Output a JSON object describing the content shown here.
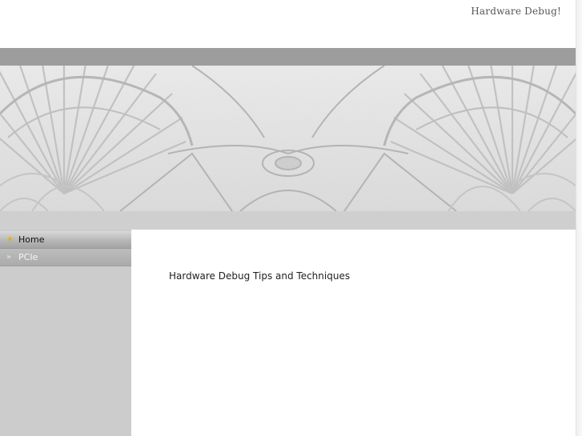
{
  "header": {
    "site_title": "Hardware Debug!"
  },
  "sidebar": {
    "items": [
      {
        "label": "Home",
        "icon": "star-icon",
        "active": true
      },
      {
        "label": "PCIe",
        "icon": "double-chevron-right-icon",
        "active": false
      }
    ]
  },
  "main": {
    "tagline": "Hardware Debug Tips and Techniques"
  },
  "colors": {
    "top_bar": "#9d9d9d",
    "sub_bar": "#cfcfcf",
    "sidebar": "#cccccc",
    "home_icon": "#e0b21c"
  }
}
